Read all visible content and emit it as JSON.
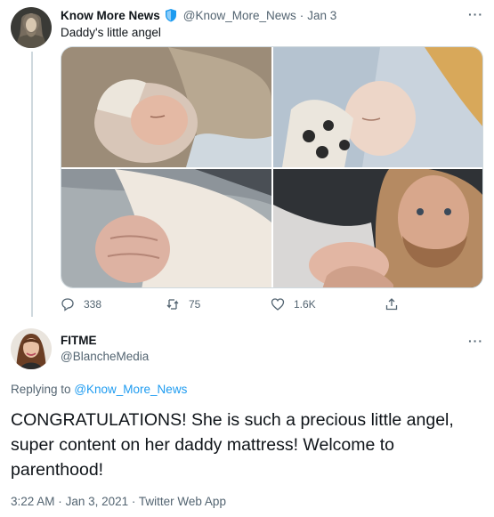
{
  "tweet": {
    "display_name": "Know More News",
    "handle": "@Know_More_News",
    "separator": "·",
    "date": "Jan 3",
    "text": "Daddy's little angel",
    "more_label": "···",
    "actions": {
      "reply_count": "338",
      "retweet_count": "75",
      "like_count": "1.6K"
    },
    "verified_color": "#1d9bf0"
  },
  "reply": {
    "display_name": "FITME",
    "handle": "@BlancheMedia",
    "more_label": "···",
    "replying_prefix": "Replying to",
    "replying_to": "@Know_More_News",
    "text": "CONGRATULATIONS! She is such a precious little angel, super content on her daddy mattress! Welcome to parenthood!",
    "time": "3:22 AM",
    "separator": "·",
    "date": "Jan 3, 2021",
    "source": "Twitter Web App"
  },
  "colors": {
    "accent": "#1d9bf0",
    "muted": "#536471",
    "text": "#0f1419",
    "line": "#cfd9de"
  }
}
